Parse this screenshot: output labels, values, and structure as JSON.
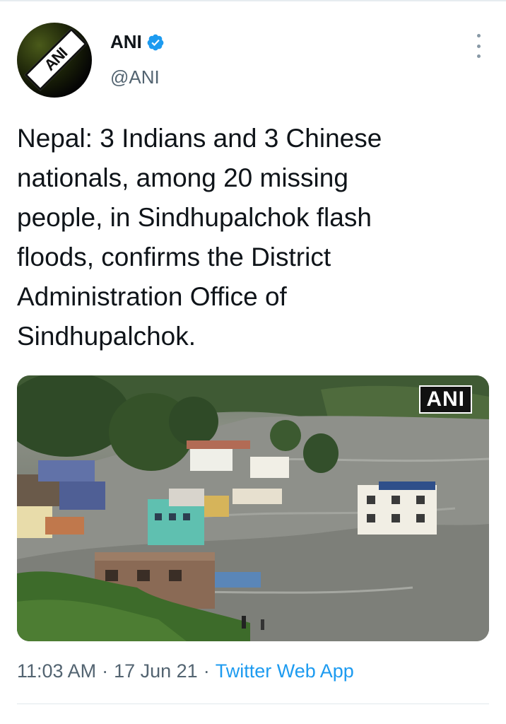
{
  "author": {
    "display_name": "ANI",
    "handle": "@ANI",
    "avatar_logo_text": "ANI",
    "verified": true,
    "verified_color": "#1d9bf0"
  },
  "tweet": {
    "text": "Nepal: 3 Indians and 3 Chinese\nnationals, among 20 missing\npeople, in Sindhupalchok flash\nfloods, confirms the District\nAdministration Office of\nSindhupalchok."
  },
  "media": {
    "watermark_text": "ANI"
  },
  "meta": {
    "time": "11:03 AM",
    "date": "17 Jun 21",
    "separator": "·",
    "source": "Twitter Web App"
  },
  "icons": {
    "more": "more-vertical-icon",
    "verified": "verified-badge-icon"
  },
  "colors": {
    "text_primary": "#0f1419",
    "text_secondary": "#536471",
    "link": "#1d9bf0"
  }
}
